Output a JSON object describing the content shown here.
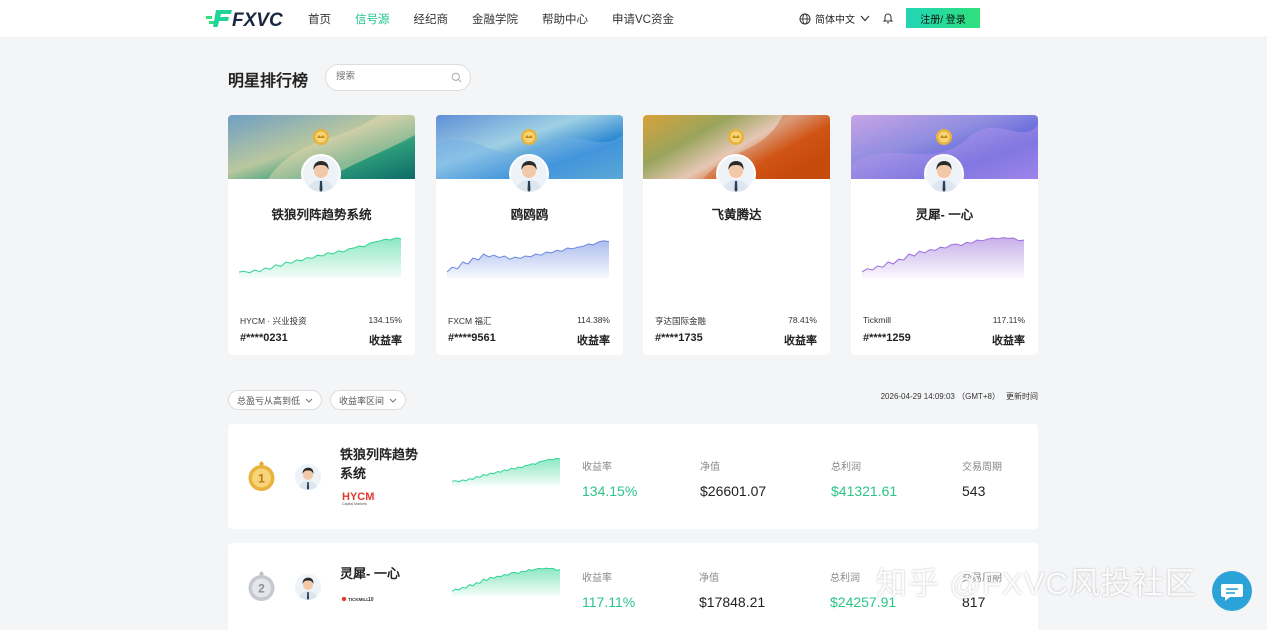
{
  "brand": {
    "logo_text": "FXVC",
    "accent": "#1ec38c"
  },
  "nav": {
    "links": [
      "首页",
      "信号源",
      "经纪商",
      "金融学院",
      "帮助中心",
      "申请VC资金"
    ],
    "active_index": 1,
    "language": "简体中文",
    "register_label": "注册/ 登录"
  },
  "header": {
    "title": "明星排行榜",
    "search_placeholder": "搜索"
  },
  "star_cards": [
    {
      "name": "铁狼列阵趋势系统",
      "broker": "HYCM · 兴业投资",
      "return": "134.15%",
      "account": "#****0231",
      "return_label": "收益率",
      "chart_color": "#2fd493"
    },
    {
      "name": "鸥鸥鸥",
      "broker": "FXCM 福汇",
      "return": "114.38%",
      "account": "#****9561",
      "return_label": "收益率",
      "chart_color": "#6a87e0"
    },
    {
      "name": "飞黄腾达",
      "broker": "亨达国际金融",
      "return": "78.41%",
      "account": "#****1735",
      "return_label": "收益率",
      "chart_color": ""
    },
    {
      "name": "灵犀- 一心",
      "broker": "Tickmill",
      "return": "117.11%",
      "account": "#****1259",
      "return_label": "收益率",
      "chart_color": "#9b6fd8"
    }
  ],
  "filters": {
    "sort": "总盈亏从高到低",
    "range": "收益率区间"
  },
  "update": {
    "time": "2026-04-29 14:09:03 （GMT+8）",
    "label": "更新时间"
  },
  "rows": [
    {
      "rank": "1",
      "name": "铁狼列阵趋势系统",
      "broker_logo": "HYCM",
      "broker_sub": "Capital Markets",
      "return_label": "收益率",
      "return": "134.15%",
      "nav_label": "净值",
      "nav": "$26601.07",
      "profit_label": "总利润",
      "profit": "$41321.61",
      "period_label": "交易周期",
      "period": "543"
    },
    {
      "rank": "2",
      "name": "灵犀- 一心",
      "broker_logo": "TICKMILL",
      "broker_sub": "10",
      "return_label": "收益率",
      "return": "117.11%",
      "nav_label": "净值",
      "nav": "$17848.21",
      "profit_label": "总利润",
      "profit": "$24257.91",
      "period_label": "交易周期",
      "period": "817"
    }
  ],
  "watermark": "知乎 @FXVC风投社区"
}
